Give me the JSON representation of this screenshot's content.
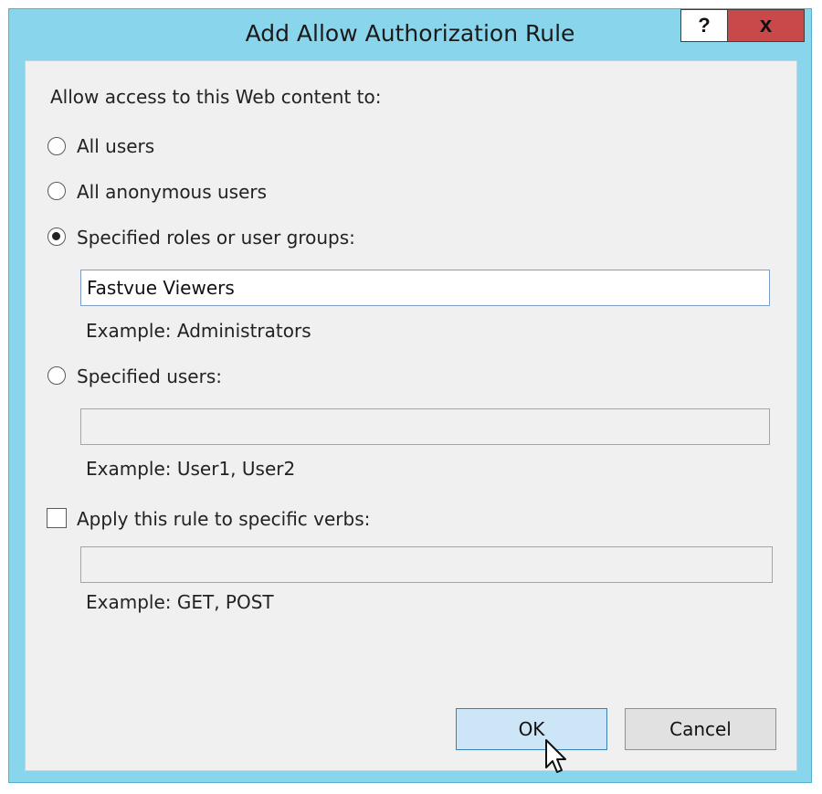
{
  "window": {
    "title": "Add Allow Authorization Rule",
    "help_label": "?",
    "close_label": "x"
  },
  "form": {
    "intro_label": "Allow access to this Web content to:",
    "options": [
      {
        "label": "All users",
        "selected": false
      },
      {
        "label": "All anonymous users",
        "selected": false
      },
      {
        "label": "Specified roles or user groups:",
        "selected": true
      },
      {
        "label": "Specified users:",
        "selected": false
      }
    ],
    "roles_value": "Fastvue Viewers",
    "roles_example": "Example: Administrators",
    "users_value": "",
    "users_example": "Example: User1, User2",
    "verbs_checkbox_label": "Apply this rule to specific verbs:",
    "verbs_checked": false,
    "verbs_value": "",
    "verbs_example": "Example: GET, POST"
  },
  "buttons": {
    "ok_label": "OK",
    "cancel_label": "Cancel"
  },
  "colors": {
    "frame": "#89d6ec",
    "close": "#c9484a",
    "client": "#f0f0f0",
    "ok_fill": "#cde6f7",
    "ok_border": "#3c7fb1"
  },
  "icons": [
    "help-icon",
    "close-icon",
    "mouse-pointer-icon"
  ]
}
